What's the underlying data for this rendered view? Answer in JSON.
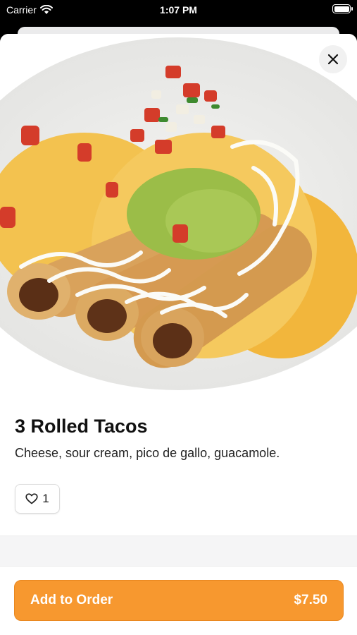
{
  "status_bar": {
    "carrier": "Carrier",
    "time": "1:07 PM"
  },
  "item": {
    "title": "3 Rolled Tacos",
    "description": "Cheese, sour cream, pico de gallo, guacamole.",
    "like_count": "1",
    "image_icon": "rolled-tacos-photo"
  },
  "actions": {
    "close_icon": "close-icon",
    "add_label": "Add to Order",
    "price": "$7.50"
  },
  "colors": {
    "accent": "#f7982f",
    "plate": "#ffffff",
    "background": "#000000"
  }
}
